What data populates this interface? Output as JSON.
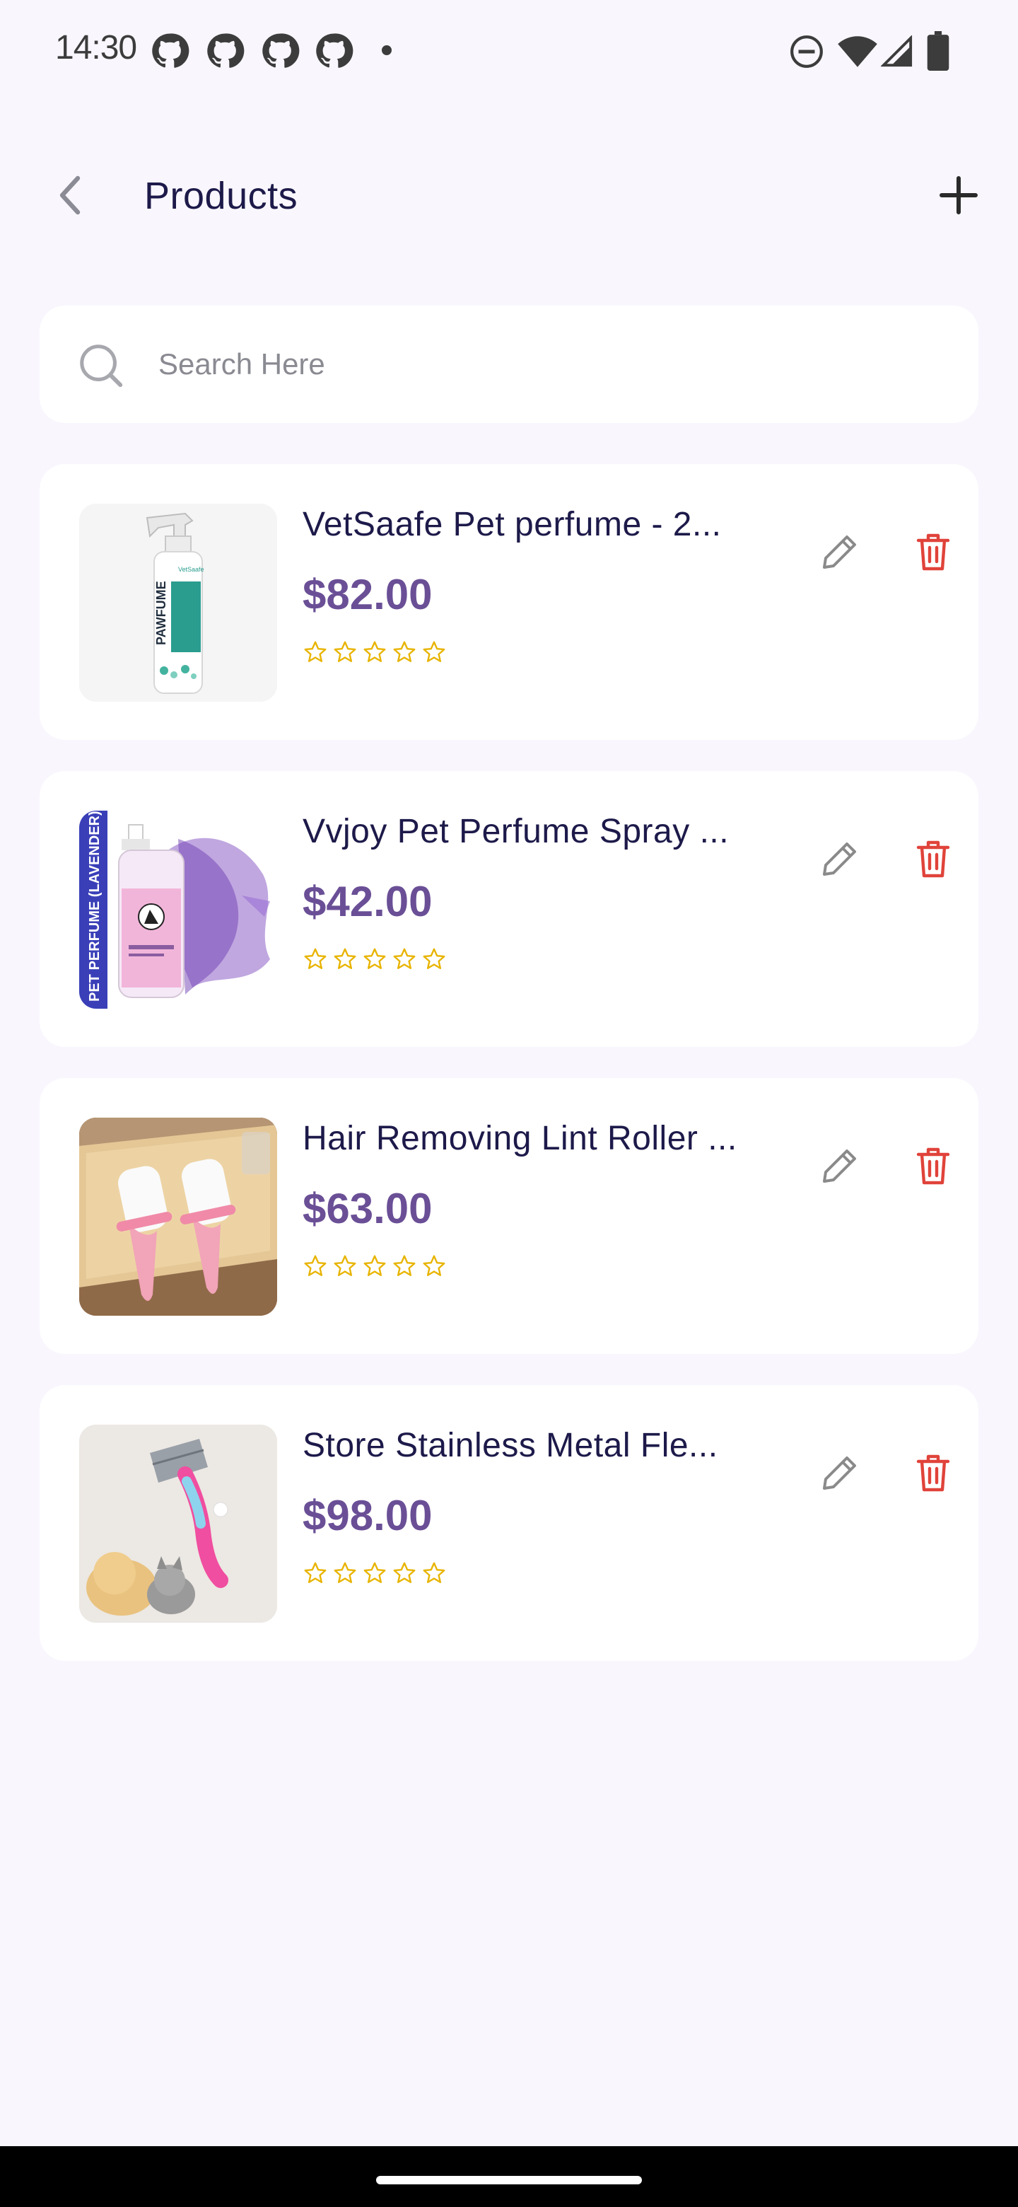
{
  "status_bar": {
    "time": "14:30",
    "notification_icons": [
      "github-icon",
      "github-icon",
      "github-icon",
      "github-icon"
    ],
    "system_icons": [
      "do-not-disturb-icon",
      "wifi-icon",
      "signal-icon",
      "battery-icon"
    ]
  },
  "header": {
    "title": "Products",
    "back_icon": "chevron-left-icon",
    "add_icon": "plus-icon"
  },
  "search": {
    "placeholder": "Search Here",
    "value": ""
  },
  "products": [
    {
      "name": "VetSaafe Pet perfume - 2...",
      "price": "$82.00",
      "rating": 0,
      "image": "pawfume-spray-bottle"
    },
    {
      "name": "Vvjoy Pet Perfume Spray ...",
      "price": "$42.00",
      "rating": 0,
      "image": "lavender-pet-perfume"
    },
    {
      "name": "Hair Removing Lint Roller ...",
      "price": "$63.00",
      "rating": 0,
      "image": "pink-lint-rollers"
    },
    {
      "name": "Store Stainless Metal Fle...",
      "price": "$98.00",
      "rating": 0,
      "image": "flea-comb-with-pets"
    }
  ],
  "colors": {
    "background": "#f9f6fd",
    "title": "#1d1a4a",
    "price": "#6a4f96",
    "star": "#e8b400",
    "delete": "#e0433a",
    "edit": "#8a8a8a"
  }
}
